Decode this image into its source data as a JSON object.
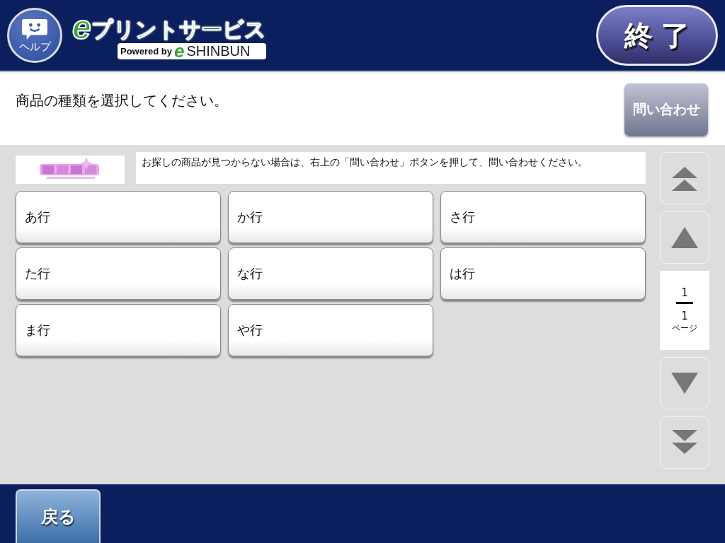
{
  "header": {
    "help_label": "ヘルプ",
    "logo": {
      "mark": "e",
      "title": "プリントサービス",
      "powered": "Powered by",
      "brand_mark": "e",
      "brand": "SHINBUN"
    },
    "exit_button": "終 了"
  },
  "prompt": {
    "text": "商品の種類を選択してください。",
    "contact_button": "問い合わせ"
  },
  "notice": {
    "text": "お探しの商品が見つからない場合は、右上の「問い合わせ」ボタンを押して、問い合わせください。"
  },
  "options": [
    {
      "label": "あ行"
    },
    {
      "label": "か行"
    },
    {
      "label": "さ行"
    },
    {
      "label": "た行"
    },
    {
      "label": "な行"
    },
    {
      "label": "は行"
    },
    {
      "label": "ま行"
    },
    {
      "label": "や行"
    }
  ],
  "pager": {
    "current": "1",
    "total": "1",
    "unit": "ページ"
  },
  "footer": {
    "back_button": "戻る"
  }
}
